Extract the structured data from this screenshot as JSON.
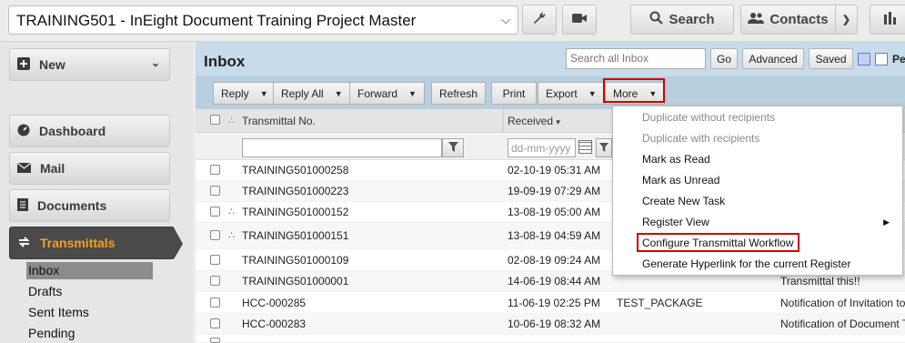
{
  "project": {
    "title": "TRAINING501 - InEight Document Training Project Master"
  },
  "topbar": {
    "search_label": "Search",
    "contacts_label": "Contacts"
  },
  "sidebar": {
    "new_label": "New",
    "items": [
      {
        "label": "Dashboard",
        "icon": "dashboard-icon"
      },
      {
        "label": "Mail",
        "icon": "mail-icon"
      },
      {
        "label": "Documents",
        "icon": "documents-icon"
      },
      {
        "label": "Transmittals",
        "icon": "transmittals-icon"
      }
    ],
    "subitems": [
      "Inbox",
      "Drafts",
      "Sent Items",
      "Pending"
    ]
  },
  "inbox": {
    "title": "Inbox",
    "search_placeholder": "Search all Inbox",
    "go_label": "Go",
    "advanced_label": "Advanced",
    "saved_label": "Saved",
    "cut_label": "Pe"
  },
  "toolbar": {
    "reply": "Reply",
    "reply_all": "Reply All",
    "forward": "Forward",
    "refresh": "Refresh",
    "print": "Print",
    "export": "Export",
    "more": "More"
  },
  "columns": {
    "transmittal_no": "Transmittal No.",
    "received": "Received"
  },
  "filters": {
    "date_placeholder": "dd-mm-yyyy"
  },
  "rows": [
    {
      "no": "TRAINING501000258",
      "received": "02-10-19 05:31 AM",
      "package": "",
      "subject": "",
      "attach": false
    },
    {
      "no": "TRAINING501000223",
      "received": "19-09-19 07:29 AM",
      "package": "",
      "subject": "",
      "attach": false
    },
    {
      "no": "TRAINING501000152",
      "received": "13-08-19 05:00 AM",
      "package": "",
      "subject": "",
      "attach": true
    },
    {
      "no": "TRAINING501000151",
      "received": "13-08-19 04:59 AM",
      "package": "",
      "subject": "",
      "attach": true
    },
    {
      "no": "TRAINING501000109",
      "received": "02-08-19 09:24 AM",
      "package": "",
      "subject": "",
      "attach": false
    },
    {
      "no": "TRAINING501000001",
      "received": "14-06-19 08:44 AM",
      "package": "",
      "subject": "Transmittal this!!",
      "attach": false
    },
    {
      "no": "HCC-000285",
      "received": "11-06-19 02:25 PM",
      "package": "TEST_PACKAGE",
      "subject": "Notification of Invitation to",
      "attach": false
    },
    {
      "no": "HCC-000283",
      "received": "10-06-19 08:32 AM",
      "package": "",
      "subject": "Notification of Document T",
      "attach": false
    }
  ],
  "more_menu": [
    {
      "label": "Duplicate without recipients",
      "disabled": true
    },
    {
      "label": "Duplicate with recipients",
      "disabled": true
    },
    {
      "label": "Mark as Read",
      "disabled": false
    },
    {
      "label": "Mark as Unread",
      "disabled": false
    },
    {
      "label": "Create New Task",
      "disabled": false
    },
    {
      "label": "Register View",
      "disabled": false,
      "submenu": true
    },
    {
      "label": "Configure Transmittal Workflow",
      "disabled": false
    },
    {
      "label": "Generate Hyperlink for the current Register",
      "disabled": false
    }
  ],
  "colors": {
    "active_accent": "#f4a21a",
    "highlight": "#d00000",
    "header_blue": "#c6dcea"
  }
}
